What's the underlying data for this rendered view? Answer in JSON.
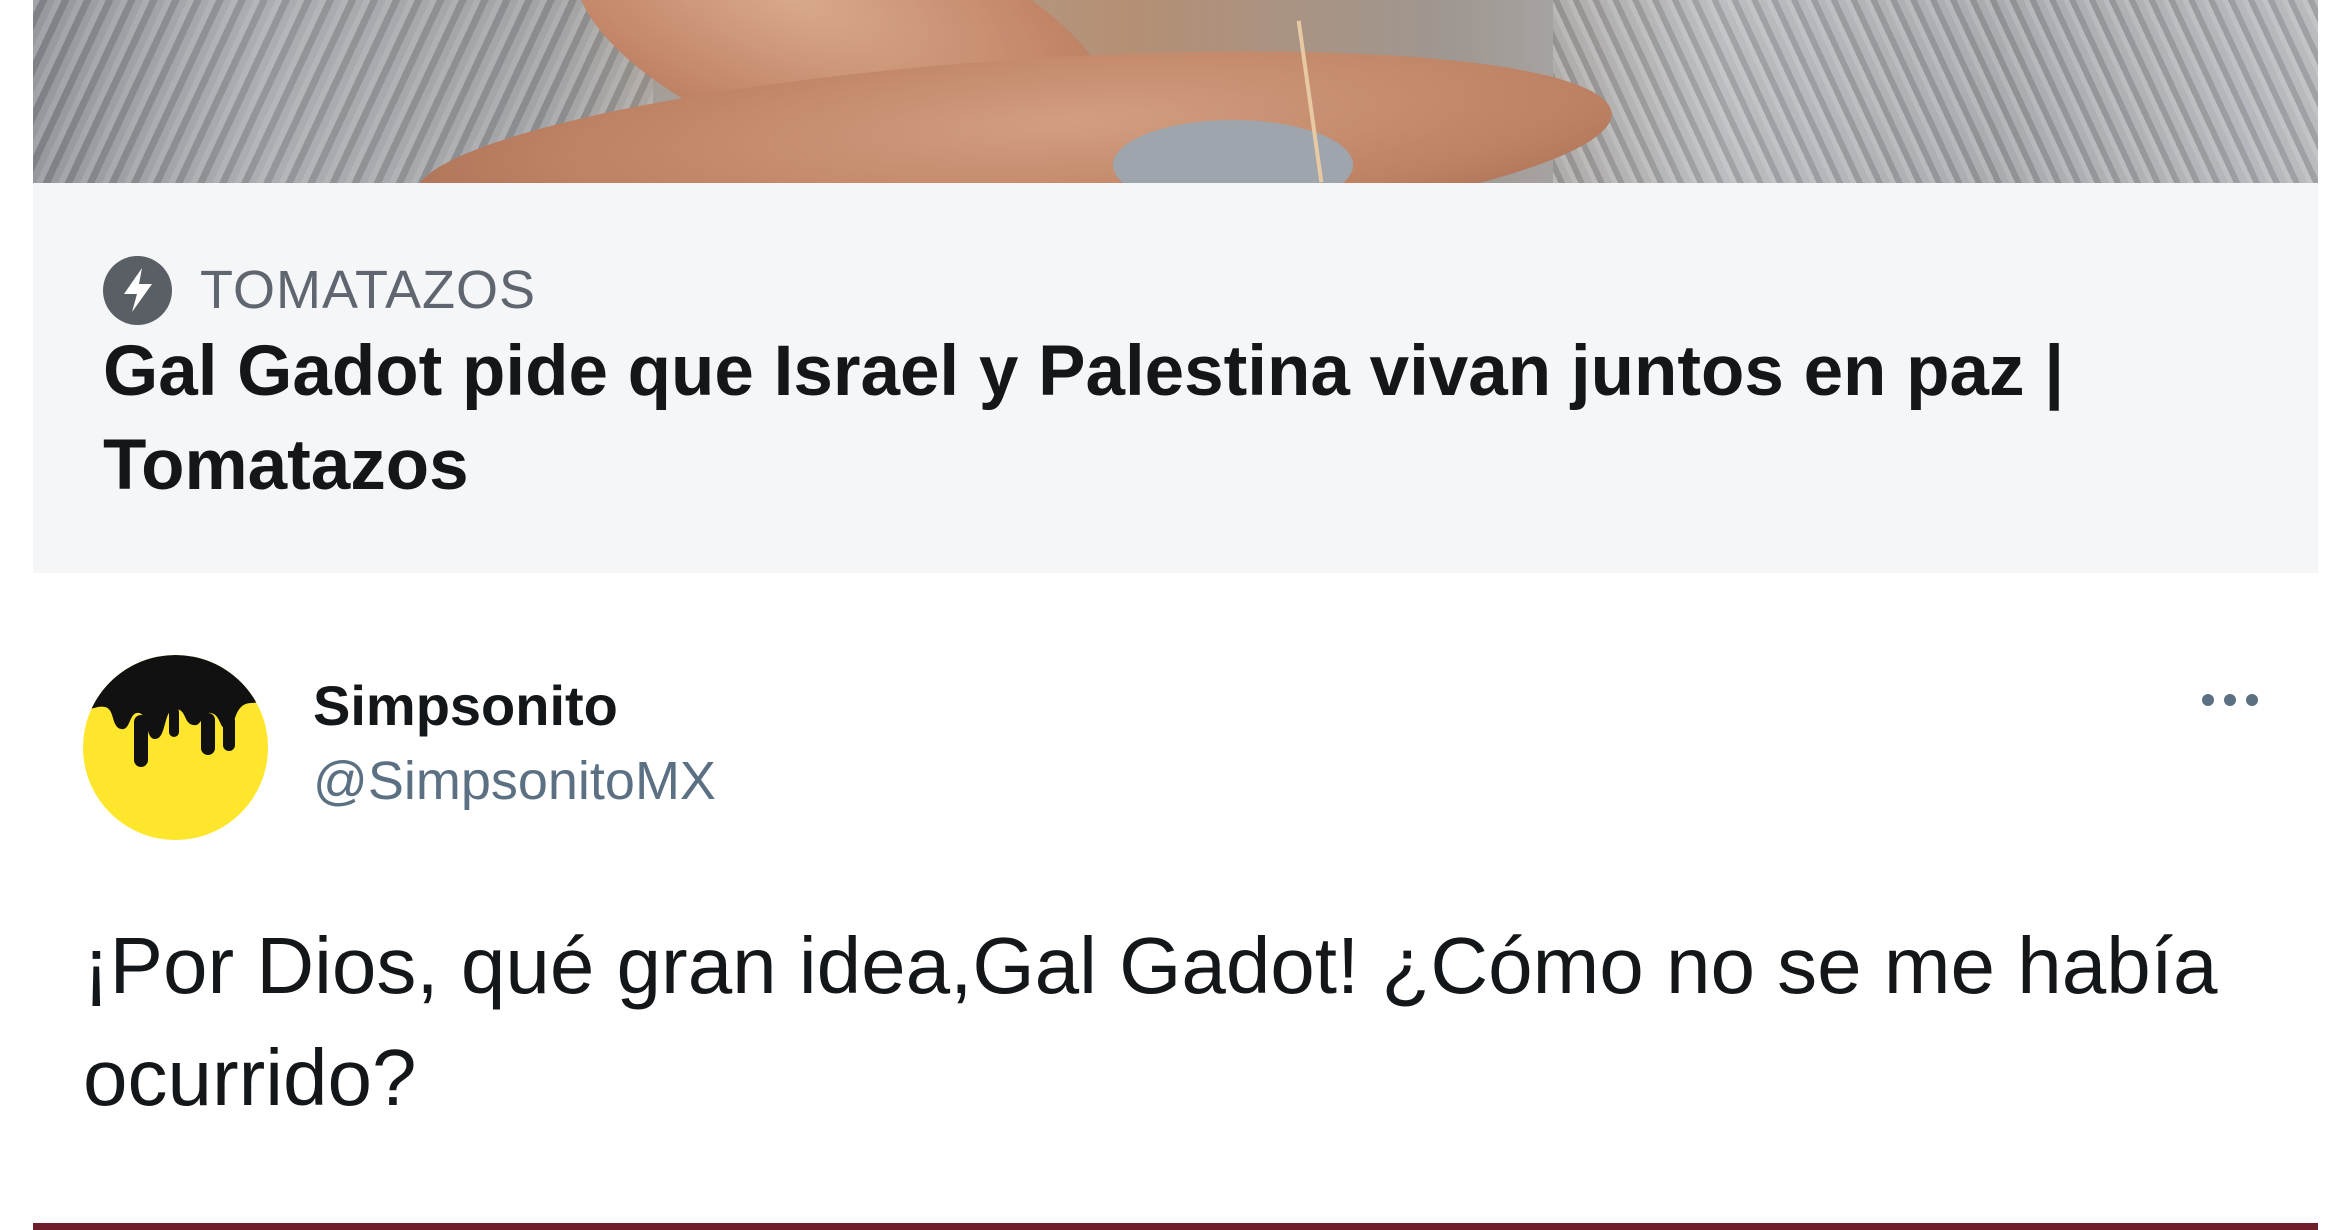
{
  "link_card": {
    "source": "TOMATAZOS",
    "title": "Gal Gadot pide que Israel y Palestina vivan juntos en paz | Tomatazos",
    "source_icon": "bolt-icon"
  },
  "tweet": {
    "author_name": "Simpsonito",
    "author_handle": "@SimpsonitoMX",
    "text": "¡Por Dios, qué gran idea,Gal Gadot! ¿Cómo no se me había ocurrido?",
    "more_icon": "more-options-icon"
  },
  "colors": {
    "card_background": "#f5f6f7",
    "avatar_background": "#fde62c",
    "handle_color": "#5b7083",
    "text_color": "#14171a"
  }
}
